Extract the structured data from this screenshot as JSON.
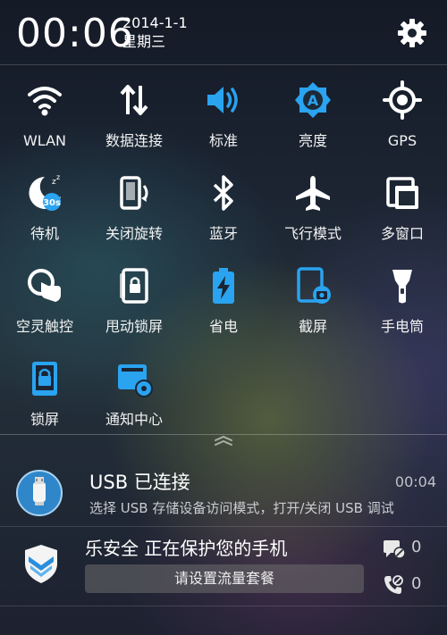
{
  "header": {
    "time": "00:06",
    "date": "2014-1-1",
    "weekday": "星期三",
    "settings_icon": "gear-icon"
  },
  "tiles": [
    {
      "label": "WLAN",
      "icon": "wifi-icon",
      "active": false
    },
    {
      "label": "数据连接",
      "icon": "data-sync-icon",
      "active": false
    },
    {
      "label": "标准",
      "icon": "volume-icon",
      "active": true
    },
    {
      "label": "亮度",
      "icon": "brightness-auto-icon",
      "active": true
    },
    {
      "label": "GPS",
      "icon": "gps-icon",
      "active": false
    },
    {
      "label": "待机",
      "icon": "standby-moon-icon",
      "active": true,
      "badge": "30s"
    },
    {
      "label": "关闭旋转",
      "icon": "rotation-lock-icon",
      "active": false
    },
    {
      "label": "蓝牙",
      "icon": "bluetooth-icon",
      "active": false
    },
    {
      "label": "飞行模式",
      "icon": "airplane-icon",
      "active": false
    },
    {
      "label": "多窗口",
      "icon": "multi-window-icon",
      "active": false
    },
    {
      "label": "空灵触控",
      "icon": "touch-gesture-icon",
      "active": false
    },
    {
      "label": "甩动锁屏",
      "icon": "shake-lock-icon",
      "active": false
    },
    {
      "label": "省电",
      "icon": "battery-saver-icon",
      "active": true
    },
    {
      "label": "截屏",
      "icon": "screenshot-icon",
      "active": true
    },
    {
      "label": "手电筒",
      "icon": "flashlight-icon",
      "active": false
    },
    {
      "label": "锁屏",
      "icon": "lock-screen-icon",
      "active": true
    },
    {
      "label": "通知中心",
      "icon": "notification-center-icon",
      "active": true
    }
  ],
  "notifications": {
    "usb": {
      "title": "USB 已连接",
      "time": "00:04",
      "body": "选择 USB 存储设备访问模式，打开/关闭 USB 调试",
      "icon": "usb-icon"
    },
    "security": {
      "title": "乐安全 正在保护您的手机",
      "button": "请设置流量套餐",
      "sms_count": "0",
      "call_count": "0",
      "icon": "shield-icon"
    }
  },
  "colors": {
    "accent": "#2aa3f0",
    "icon_white": "#ffffff"
  }
}
